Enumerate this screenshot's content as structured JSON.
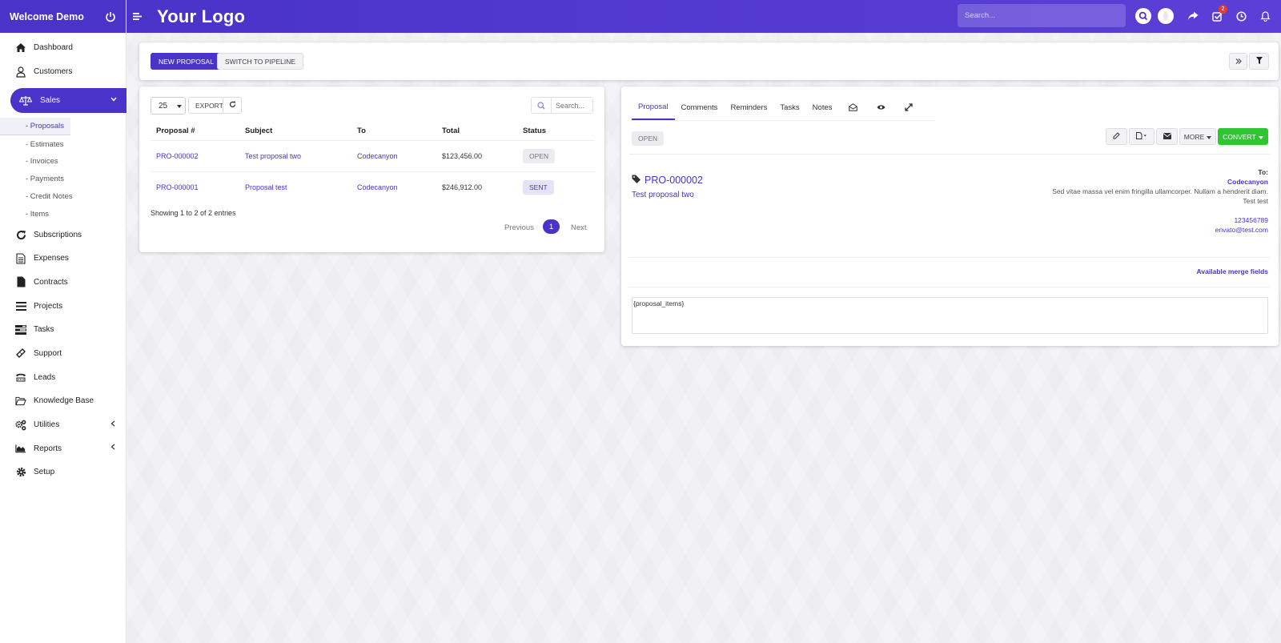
{
  "sidebar": {
    "welcome": "Welcome Demo",
    "items_top": [
      {
        "label": "Dashboard",
        "icon": "home-icon"
      },
      {
        "label": "Customers",
        "icon": "user-icon"
      }
    ],
    "sales_label": "Sales",
    "sales_sub": [
      "- Proposals",
      "- Estimates",
      "- Invoices",
      "- Payments",
      "- Credit Notes",
      "- Items"
    ],
    "items_bottom": [
      {
        "label": "Subscriptions",
        "icon": "refresh-icon"
      },
      {
        "label": "Expenses",
        "icon": "file-text-icon"
      },
      {
        "label": "Contracts",
        "icon": "file-icon"
      },
      {
        "label": "Projects",
        "icon": "bars-icon"
      },
      {
        "label": "Tasks",
        "icon": "tasks-icon"
      },
      {
        "label": "Support",
        "icon": "ticket-icon"
      },
      {
        "label": "Leads",
        "icon": "tty-icon"
      },
      {
        "label": "Knowledge Base",
        "icon": "folder-open-icon"
      },
      {
        "label": "Utilities",
        "icon": "cogs-icon"
      },
      {
        "label": "Reports",
        "icon": "area-chart-icon"
      },
      {
        "label": "Setup",
        "icon": "cog-icon"
      }
    ]
  },
  "topbar": {
    "logo": "Your Logo",
    "search_placeholder": "Search...",
    "task_badge": "2"
  },
  "toolbar": {
    "new_proposal": "NEW PROPOSAL",
    "switch_pipeline": "SWITCH TO PIPELINE"
  },
  "list": {
    "page_length": "25",
    "export": "EXPORT",
    "search_placeholder": "Search...",
    "columns": [
      "Proposal #",
      "Subject",
      "To",
      "Total",
      "Status"
    ],
    "rows": [
      {
        "number": "PRO-000002",
        "subject": "Test proposal two",
        "to": "Codecanyon",
        "total": "$123,456.00",
        "status": "OPEN"
      },
      {
        "number": "PRO-000001",
        "subject": "Proposal test",
        "to": "Codecanyon",
        "total": "$246,912.00",
        "status": "SENT"
      }
    ],
    "info": "Showing 1 to 2 of 2 entries",
    "prev": "Previous",
    "page": "1",
    "next": "Next"
  },
  "detail": {
    "tabs": [
      "Proposal",
      "Comments",
      "Reminders",
      "Tasks",
      "Notes"
    ],
    "status": "OPEN",
    "more": "MORE",
    "convert": "CONVERT",
    "number": "PRO-000002",
    "subject": "Test proposal two",
    "to_label": "To:",
    "to_name": "Codecanyon",
    "address": "Sed vitae massa vel enim fringilla ullamcorper. Nullam a hendrerit diam.",
    "address2": "Test test",
    "phone": "123456789",
    "email": "envato@test.com",
    "merge_fields": "Available merge fields",
    "content": "{proposal_items}"
  },
  "colors": {
    "primary": "#4a33c9",
    "success": "#2fc432"
  }
}
